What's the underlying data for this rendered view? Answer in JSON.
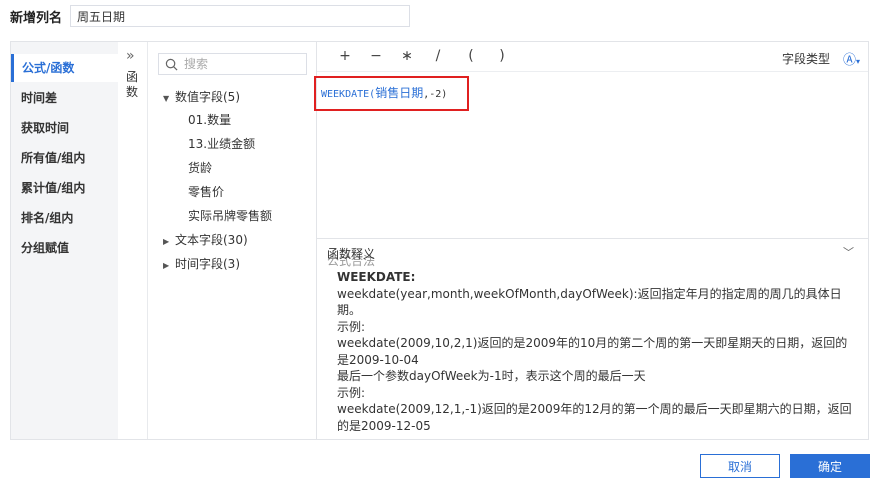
{
  "top": {
    "label": "新增列名",
    "column_name": "周五日期"
  },
  "categories": [
    {
      "label": "公式/函数",
      "active": true
    },
    {
      "label": "时间差",
      "active": false
    },
    {
      "label": "获取时间",
      "active": false
    },
    {
      "label": "所有值/组内",
      "active": false
    },
    {
      "label": "累计值/组内",
      "active": false
    },
    {
      "label": "排名/组内",
      "active": false
    },
    {
      "label": "分组赋值",
      "active": false
    }
  ],
  "function_strip": {
    "chevron": "»",
    "label_1": "函",
    "label_2": "数"
  },
  "fields": {
    "search_placeholder": "搜索",
    "groups": [
      {
        "label": "数值字段(5)",
        "expanded": true,
        "children": [
          "01.数量",
          "13.业绩金额",
          "货龄",
          "零售价",
          "实际吊牌零售额"
        ]
      },
      {
        "label": "文本字段(30)",
        "expanded": false,
        "children": []
      },
      {
        "label": "时间字段(3)",
        "expanded": false,
        "children": []
      }
    ]
  },
  "toolbar": {
    "ops": [
      "+",
      "−",
      "∗",
      "/",
      "(",
      ")"
    ],
    "field_type_label": "字段类型",
    "field_type_icon": "Ⓐ"
  },
  "formula": {
    "func": "WEEKDATE(",
    "field": "销售日期",
    "args": ",-2)",
    "status": "公式合法",
    "highlight_color": "#e02020"
  },
  "description": {
    "header": "函数释义",
    "title": "WEEKDATE:",
    "lines": [
      "weekdate(year,month,weekOfMonth,dayOfWeek):返回指定年月的指定周的周几的具体日期。",
      "示例:",
      "weekdate(2009,10,2,1)返回的是2009年的10月的第二个周的第一天即星期天的日期，返回的是2009-10-04",
      "最后一个参数dayOfWeek为-1时，表示这个周的最后一天",
      "示例:",
      "weekdate(2009,12,1,-1)返回的是2009年的12月的第一个周的最后一天即星期六的日期，返回的是2009-12-05"
    ]
  },
  "buttons": {
    "cancel": "取消",
    "ok": "确定"
  },
  "colors": {
    "accent": "#2a6fd6",
    "category_bg": "#f4f5f7"
  }
}
